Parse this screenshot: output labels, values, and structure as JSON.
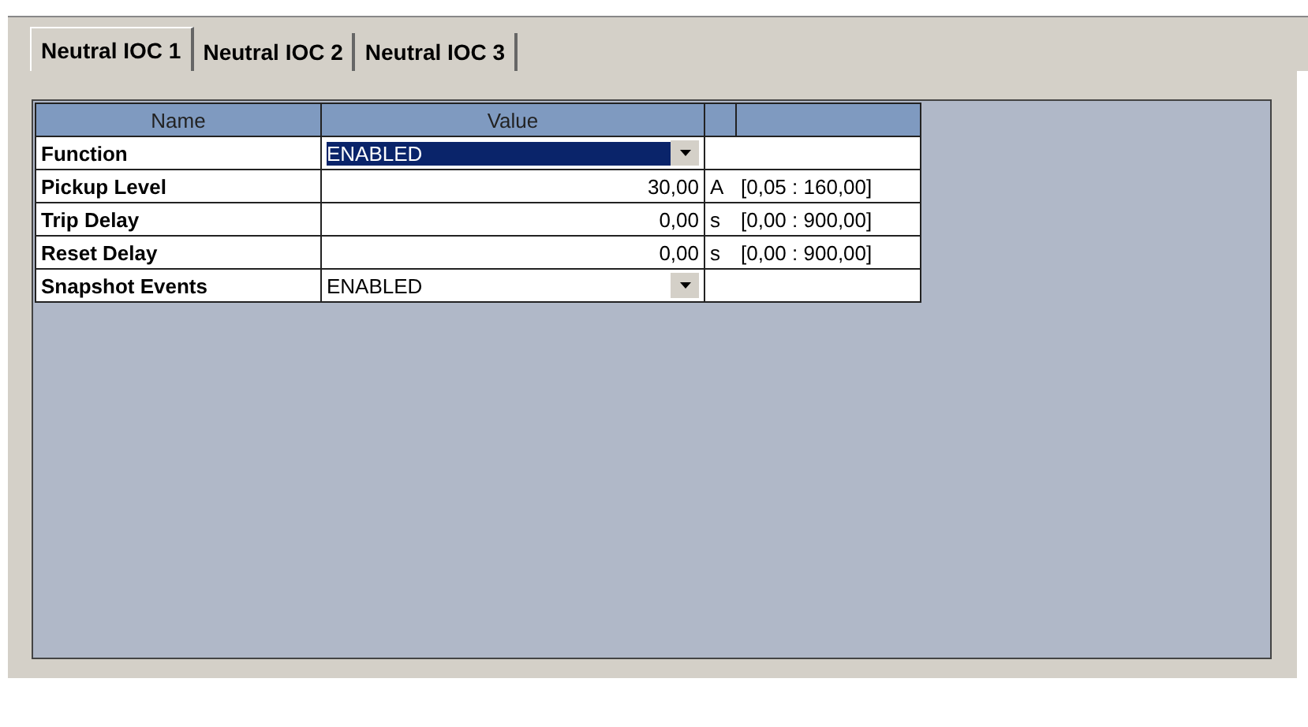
{
  "tabs": [
    {
      "label": "Neutral IOC 1",
      "selected": true
    },
    {
      "label": "Neutral IOC 2",
      "selected": false
    },
    {
      "label": "Neutral IOC 3",
      "selected": false
    }
  ],
  "table": {
    "columns": [
      "Name",
      "Value"
    ],
    "rows": [
      {
        "name": "Function",
        "kind": "dropdown",
        "value": "ENABLED",
        "selected": true
      },
      {
        "name": "Pickup Level",
        "kind": "number",
        "value": "30,00",
        "unit": "A",
        "range": "[0,05 : 160,00]",
        "selected": false
      },
      {
        "name": "Trip Delay",
        "kind": "number",
        "value": "0,00",
        "unit": "s",
        "range": "[0,00 : 900,00]",
        "selected": false
      },
      {
        "name": "Reset Delay",
        "kind": "number",
        "value": "0,00",
        "unit": "s",
        "range": "[0,00 : 900,00]",
        "selected": false
      },
      {
        "name": "Snapshot Events",
        "kind": "dropdown",
        "value": "ENABLED",
        "selected": false
      }
    ]
  }
}
